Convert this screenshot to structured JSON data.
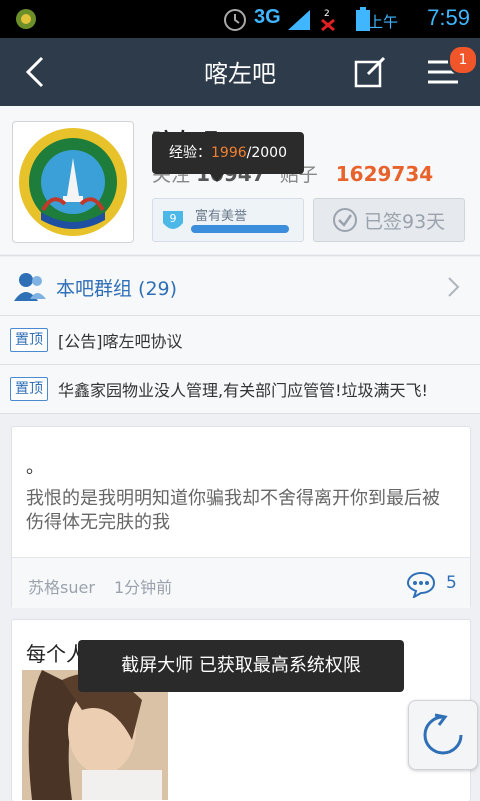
{
  "status_bar": {
    "network": "3G",
    "ampm": "上午",
    "time": "7:59",
    "icons": [
      "app-notify-icon",
      "alarm-icon",
      "signal-icon",
      "sim2-noservice-icon",
      "battery-icon"
    ]
  },
  "nav": {
    "title": "喀左吧",
    "badge": "1",
    "icons": [
      "back-arrow-icon",
      "edit-icon",
      "menu-icon"
    ]
  },
  "forum": {
    "name": "喀左吧",
    "followers_label": "关注",
    "followers": "10947",
    "posts_label": "贴子",
    "posts": "1629734",
    "exp_label": "经验：",
    "exp_current": "1996",
    "exp_total": "/2000",
    "level": "9",
    "level_name": "富有美誉",
    "level_progress": 0.998,
    "sign_label": "已签93天"
  },
  "group": {
    "label": "本吧群组 (29)"
  },
  "pinned": [
    {
      "tag": "置顶",
      "text": "[公告]喀左吧协议"
    },
    {
      "tag": "置顶",
      "text": "华鑫家园物业没人管理,有关部门应管管!垃圾满天飞!"
    }
  ],
  "posts": [
    {
      "title": "。",
      "body": "我恨的是我明明知道你骗我却不舍得离开你到最后被伤得体无完肤的我",
      "author": "苏格suer",
      "time": "1分钟前",
      "replies": "5"
    },
    {
      "title": "每个人"
    }
  ],
  "toast": "截屏大师 已获取最高系统权限",
  "colors": {
    "nav_bg": "#2d3b4b",
    "accent_blue": "#2f6fb6",
    "accent_orange": "#e8622c",
    "badge": "#f0562a"
  }
}
